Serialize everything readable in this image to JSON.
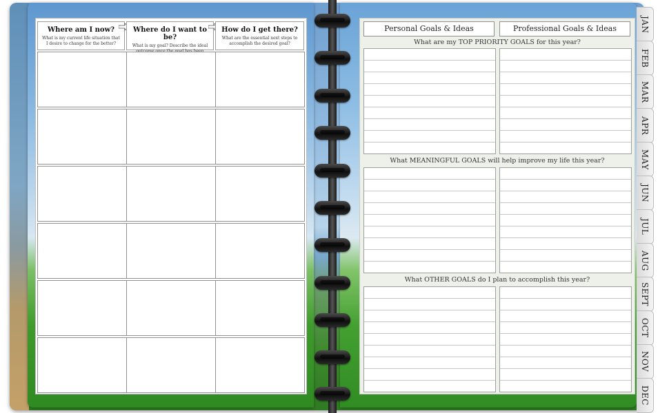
{
  "left": {
    "columns": [
      {
        "title": "Where am I now?",
        "subtitle": "What is my current life situation that I desire to change for the better?"
      },
      {
        "title": "Where do I want to be?",
        "subtitle": "What is my goal? Describe the ideal outcome once the goal has been achieved."
      },
      {
        "title": "How do I get there?",
        "subtitle": "What are the essential next steps to accomplish the desired goal?"
      }
    ]
  },
  "right": {
    "col1": "Personal Goals & Ideas",
    "col2": "Professional Goals & Ideas",
    "q1": "What are my TOP PRIORITY GOALS for this year?",
    "q2": "What MEANINGFUL GOALS will help improve my life this year?",
    "q3": "What OTHER GOALS do I plan to accomplish this year?"
  },
  "tabs": [
    "JAN",
    "FEB",
    "MAR",
    "APR",
    "MAY",
    "JUN",
    "JUL",
    "AUG",
    "SEPT",
    "OCT",
    "NOV",
    "DEC"
  ],
  "colors": {
    "cover_accent": "#3f8a2e",
    "sheet_bg": "#edf1ea"
  }
}
